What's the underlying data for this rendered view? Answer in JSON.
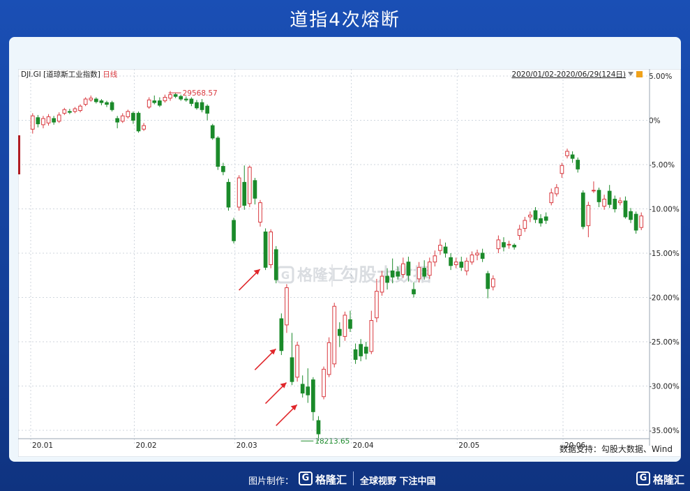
{
  "page": {
    "title": "道指4次熔断",
    "source": "数据支持：勾股大数据、Wind",
    "footer": {
      "made_by": "图片制作：",
      "logo_mark": "G",
      "logo_text": "格隆汇",
      "slogan": "全球视野 下注中国",
      "logo_mark_right": "G",
      "logo_text_right": "格隆汇"
    },
    "watermark": {
      "left_mark": "G",
      "left_text": "格隆汇",
      "right_text": "勾股大数据"
    }
  },
  "colors": {
    "up": "#d9383e",
    "down": "#1b8a2a",
    "arrow": "#e0262a",
    "grid": "#cfd6de",
    "axis_text": "#222222"
  },
  "chart_data": {
    "type": "candlestick",
    "header_left": "DJI.GI [道琼斯工业指数]",
    "header_period": "日线",
    "header_right": "2020/01/02-2020/06/29(124日)",
    "ylim": [
      -38,
      5
    ],
    "yticks": [
      5,
      0,
      -5,
      -10,
      -15,
      -20,
      -25,
      -30,
      -35
    ],
    "ytick_labels": [
      "5.00%",
      "0%",
      "-5.00%",
      "-10.00%",
      "-15.00%",
      "-20.00%",
      "-25.00%",
      "-30.00%",
      "-35.00%"
    ],
    "xticks": [
      {
        "index": 0,
        "label": "20.01"
      },
      {
        "index": 20,
        "label": "20.02"
      },
      {
        "index": 39,
        "label": "20.03"
      },
      {
        "index": 61,
        "label": "20.04"
      },
      {
        "index": 81,
        "label": "20.05"
      },
      {
        "index": 101,
        "label": "20.06"
      }
    ],
    "annotations": [
      {
        "text": "29568.57",
        "index": 27,
        "value": 3.1,
        "color": "#d9383e"
      },
      {
        "text": "18213.65",
        "index": 52,
        "value": -36.2,
        "color": "#1b8a2a"
      }
    ],
    "arrows": [
      {
        "index": 44,
        "value": -16.5
      },
      {
        "index": 47,
        "value": -25.5
      },
      {
        "index": 49,
        "value": -29.3
      },
      {
        "index": 51,
        "value": -31.8
      }
    ],
    "candles": [
      {
        "o": -1.0,
        "c": 0.5,
        "h": 0.8,
        "l": -1.5
      },
      {
        "o": 0.3,
        "c": -0.4,
        "h": 0.6,
        "l": -0.8
      },
      {
        "o": -0.5,
        "c": 0.2,
        "h": 0.5,
        "l": -0.9
      },
      {
        "o": -0.3,
        "c": 0.4,
        "h": 0.7,
        "l": -0.6
      },
      {
        "o": 0.2,
        "c": -0.2,
        "h": 0.5,
        "l": -0.5
      },
      {
        "o": -0.1,
        "c": 0.6,
        "h": 0.9,
        "l": -0.3
      },
      {
        "o": 0.8,
        "c": 1.2,
        "h": 1.4,
        "l": 0.6
      },
      {
        "o": 1.0,
        "c": 0.9,
        "h": 1.3,
        "l": 0.7
      },
      {
        "o": 1.0,
        "c": 1.3,
        "h": 1.5,
        "l": 0.8
      },
      {
        "o": 1.1,
        "c": 1.6,
        "h": 1.8,
        "l": 0.9
      },
      {
        "o": 1.8,
        "c": 2.4,
        "h": 2.6,
        "l": 1.6
      },
      {
        "o": 2.3,
        "c": 2.5,
        "h": 2.8,
        "l": 2.1
      },
      {
        "o": 2.4,
        "c": 2.1,
        "h": 2.6,
        "l": 1.9
      },
      {
        "o": 2.2,
        "c": 2.0,
        "h": 2.4,
        "l": 1.7
      },
      {
        "o": 2.0,
        "c": 1.8,
        "h": 2.2,
        "l": 1.5
      },
      {
        "o": 2.0,
        "c": 1.2,
        "h": 2.2,
        "l": 1.0
      },
      {
        "o": 0.2,
        "c": -0.2,
        "h": 0.5,
        "l": -0.9
      },
      {
        "o": -0.1,
        "c": 0.5,
        "h": 0.8,
        "l": -0.3
      },
      {
        "o": 0.4,
        "c": 1.0,
        "h": 1.2,
        "l": 0.2
      },
      {
        "o": 0.8,
        "c": 0.0,
        "h": 1.0,
        "l": -0.4
      },
      {
        "o": 0.8,
        "c": -1.2,
        "h": 1.0,
        "l": -1.4
      },
      {
        "o": -1.0,
        "c": -0.6,
        "h": -0.3,
        "l": -1.2
      },
      {
        "o": 1.5,
        "c": 2.3,
        "h": 2.6,
        "l": 1.3
      },
      {
        "o": 2.2,
        "c": 2.0,
        "h": 2.8,
        "l": 1.8
      },
      {
        "o": 2.2,
        "c": 1.7,
        "h": 2.6,
        "l": 1.5
      },
      {
        "o": 2.2,
        "c": 2.6,
        "h": 2.9,
        "l": 2.0
      },
      {
        "o": 2.5,
        "c": 2.9,
        "h": 3.3,
        "l": 2.2
      },
      {
        "o": 2.9,
        "c": 2.7,
        "h": 3.1,
        "l": 2.5
      },
      {
        "o": 2.7,
        "c": 2.4,
        "h": 2.9,
        "l": 2.2
      },
      {
        "o": 2.4,
        "c": 2.3,
        "h": 2.7,
        "l": 2.1
      },
      {
        "o": 2.4,
        "c": 1.9,
        "h": 2.6,
        "l": 1.6
      },
      {
        "o": 2.0,
        "c": 1.4,
        "h": 2.3,
        "l": 1.2
      },
      {
        "o": 2.0,
        "c": 1.2,
        "h": 2.4,
        "l": 0.9
      },
      {
        "o": 1.6,
        "c": 0.8,
        "h": 1.8,
        "l": 0.0
      },
      {
        "o": -0.6,
        "c": -2.0,
        "h": -0.4,
        "l": -2.2
      },
      {
        "o": -2.0,
        "c": -5.2,
        "h": -1.8,
        "l": -5.6
      },
      {
        "o": -5.2,
        "c": -5.8,
        "h": -4.8,
        "l": -6.2
      },
      {
        "o": -7.0,
        "c": -9.8,
        "h": -6.6,
        "l": -10.2
      },
      {
        "o": -11.3,
        "c": -13.6,
        "h": -11.0,
        "l": -13.9
      },
      {
        "o": -9.8,
        "c": -6.5,
        "h": -6.2,
        "l": -10.2
      },
      {
        "o": -7.0,
        "c": -9.6,
        "h": -5.1,
        "l": -10.1
      },
      {
        "o": -9.4,
        "c": -5.3,
        "h": -5.1,
        "l": -9.8
      },
      {
        "o": -6.8,
        "c": -8.8,
        "h": -6.5,
        "l": -9.5
      },
      {
        "o": -11.5,
        "c": -9.3,
        "h": -9.0,
        "l": -12.0
      },
      {
        "o": -12.6,
        "c": -16.6,
        "h": -12.2,
        "l": -16.9
      },
      {
        "o": -16.3,
        "c": -12.6,
        "h": -12.3,
        "l": -16.7
      },
      {
        "o": -14.6,
        "c": -18.0,
        "h": -14.2,
        "l": -18.4
      },
      {
        "o": -22.4,
        "c": -26.0,
        "h": -21.8,
        "l": -26.5
      },
      {
        "o": -23.1,
        "c": -18.9,
        "h": -18.5,
        "l": -24.0
      },
      {
        "o": -26.8,
        "c": -29.5,
        "h": -24.0,
        "l": -29.9
      },
      {
        "o": -29.0,
        "c": -25.4,
        "h": -25.0,
        "l": -29.5
      },
      {
        "o": -29.8,
        "c": -30.8,
        "h": -28.8,
        "l": -31.3
      },
      {
        "o": -30.1,
        "c": -31.0,
        "h": -28.0,
        "l": -31.9
      },
      {
        "o": -29.3,
        "c": -32.9,
        "h": -29.0,
        "l": -33.9
      },
      {
        "o": -33.9,
        "c": -35.4,
        "h": -33.4,
        "l": -36.2
      },
      {
        "o": -31.2,
        "c": -28.1,
        "h": -27.8,
        "l": -31.5
      },
      {
        "o": -28.7,
        "c": -25.1,
        "h": -24.5,
        "l": -29.0
      },
      {
        "o": -27.5,
        "c": -21.0,
        "h": -20.6,
        "l": -27.9
      },
      {
        "o": -23.6,
        "c": -24.3,
        "h": -22.8,
        "l": -25.6
      },
      {
        "o": -24.4,
        "c": -22.0,
        "h": -21.6,
        "l": -24.9
      },
      {
        "o": -22.5,
        "c": -23.5,
        "h": -21.5,
        "l": -23.9
      },
      {
        "o": -25.9,
        "c": -27.0,
        "h": -25.2,
        "l": -27.5
      },
      {
        "o": -25.3,
        "c": -26.6,
        "h": -24.7,
        "l": -27.2
      },
      {
        "o": -25.6,
        "c": -26.3,
        "h": -25.0,
        "l": -27.0
      },
      {
        "o": -26.1,
        "c": -22.6,
        "h": -21.5,
        "l": -26.4
      },
      {
        "o": -22.3,
        "c": -19.3,
        "h": -17.9,
        "l": -22.8
      },
      {
        "o": -19.4,
        "c": -17.6,
        "h": -17.0,
        "l": -19.8
      },
      {
        "o": -17.6,
        "c": -18.3,
        "h": -16.7,
        "l": -19.1
      },
      {
        "o": -17.0,
        "c": -17.7,
        "h": -15.6,
        "l": -18.4
      },
      {
        "o": -17.1,
        "c": -17.6,
        "h": -16.5,
        "l": -18.0
      },
      {
        "o": -17.4,
        "c": -16.2,
        "h": -15.5,
        "l": -17.8
      },
      {
        "o": -16.0,
        "c": -17.5,
        "h": -15.4,
        "l": -18.2
      },
      {
        "o": -19.1,
        "c": -19.6,
        "h": -18.3,
        "l": -20.0
      },
      {
        "o": -17.9,
        "c": -16.6,
        "h": -16.0,
        "l": -18.3
      },
      {
        "o": -16.7,
        "c": -17.6,
        "h": -15.8,
        "l": -18.0
      },
      {
        "o": -17.5,
        "c": -16.0,
        "h": -15.5,
        "l": -17.9
      },
      {
        "o": -16.0,
        "c": -15.3,
        "h": -14.7,
        "l": -16.5
      },
      {
        "o": -14.7,
        "c": -14.1,
        "h": -13.4,
        "l": -15.2
      },
      {
        "o": -14.3,
        "c": -15.0,
        "h": -13.8,
        "l": -15.5
      },
      {
        "o": -15.5,
        "c": -16.4,
        "h": -15.0,
        "l": -16.9
      },
      {
        "o": -16.3,
        "c": -16.0,
        "h": -15.5,
        "l": -16.7
      },
      {
        "o": -16.0,
        "c": -16.6,
        "h": -15.4,
        "l": -17.0
      },
      {
        "o": -17.0,
        "c": -15.9,
        "h": -15.5,
        "l": -17.5
      },
      {
        "o": -16.0,
        "c": -15.2,
        "h": -14.8,
        "l": -16.3
      },
      {
        "o": -15.2,
        "c": -15.0,
        "h": -14.6,
        "l": -15.8
      },
      {
        "o": -15.0,
        "c": -15.6,
        "h": -14.5,
        "l": -16.0
      },
      {
        "o": -17.3,
        "c": -19.0,
        "h": -17.0,
        "l": -20.1
      },
      {
        "o": -18.8,
        "c": -17.9,
        "h": -17.5,
        "l": -19.2
      },
      {
        "o": -14.5,
        "c": -13.5,
        "h": -13.0,
        "l": -15.0
      },
      {
        "o": -13.8,
        "c": -14.3,
        "h": -13.2,
        "l": -14.8
      },
      {
        "o": -14.0,
        "c": -14.0,
        "h": -13.6,
        "l": -14.5
      },
      {
        "o": -14.1,
        "c": -14.3,
        "h": -13.9,
        "l": -14.6
      },
      {
        "o": -13.0,
        "c": -12.3,
        "h": -11.8,
        "l": -13.5
      },
      {
        "o": -12.2,
        "c": -11.3,
        "h": -10.9,
        "l": -12.6
      },
      {
        "o": -10.9,
        "c": -10.7,
        "h": -10.3,
        "l": -11.5
      },
      {
        "o": -10.2,
        "c": -11.2,
        "h": -9.8,
        "l": -11.6
      },
      {
        "o": -11.1,
        "c": -11.6,
        "h": -10.6,
        "l": -12.0
      },
      {
        "o": -10.9,
        "c": -11.3,
        "h": -10.4,
        "l": -11.7
      },
      {
        "o": -9.3,
        "c": -8.2,
        "h": -7.7,
        "l": -9.6
      },
      {
        "o": -8.3,
        "c": -7.6,
        "h": -7.2,
        "l": -8.6
      },
      {
        "o": -6.0,
        "c": -5.1,
        "h": -4.8,
        "l": -6.5
      },
      {
        "o": -4.0,
        "c": -3.5,
        "h": -3.2,
        "l": -4.3
      },
      {
        "o": -3.9,
        "c": -4.3,
        "h": -3.5,
        "l": -4.8
      },
      {
        "o": -4.5,
        "c": -5.5,
        "h": -4.2,
        "l": -5.9
      },
      {
        "o": -8.2,
        "c": -12.0,
        "h": -7.9,
        "l": -12.3
      },
      {
        "o": -11.9,
        "c": -9.6,
        "h": -9.2,
        "l": -13.2
      },
      {
        "o": -7.9,
        "c": -7.9,
        "h": -6.9,
        "l": -8.2
      },
      {
        "o": -7.9,
        "c": -9.2,
        "h": -7.6,
        "l": -9.8
      },
      {
        "o": -9.7,
        "c": -8.9,
        "h": -8.4,
        "l": -10.1
      },
      {
        "o": -8.0,
        "c": -9.5,
        "h": -7.3,
        "l": -9.9
      },
      {
        "o": -8.9,
        "c": -10.0,
        "h": -8.5,
        "l": -10.4
      },
      {
        "o": -9.3,
        "c": -9.1,
        "h": -8.7,
        "l": -9.6
      },
      {
        "o": -9.1,
        "c": -10.9,
        "h": -8.6,
        "l": -11.1
      },
      {
        "o": -10.3,
        "c": -11.2,
        "h": -9.9,
        "l": -11.6
      },
      {
        "o": -10.6,
        "c": -12.4,
        "h": -10.3,
        "l": -12.8
      },
      {
        "o": -12.1,
        "c": -10.8,
        "h": -10.4,
        "l": -12.4
      }
    ]
  }
}
